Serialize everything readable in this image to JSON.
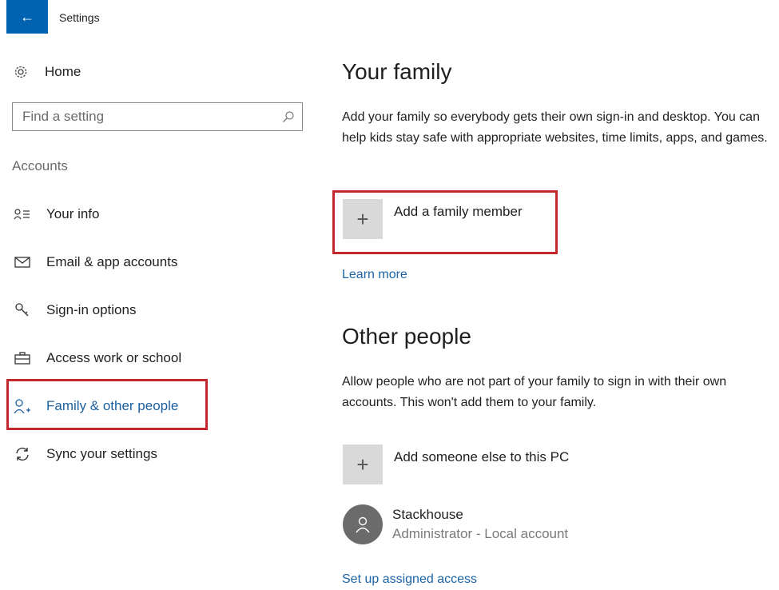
{
  "window": {
    "title": "Settings"
  },
  "sidebar": {
    "home_label": "Home",
    "search_placeholder": "Find a setting",
    "section_label": "Accounts",
    "items": [
      {
        "label": "Your info",
        "icon": "person-card-icon"
      },
      {
        "label": "Email & app accounts",
        "icon": "mail-icon"
      },
      {
        "label": "Sign-in options",
        "icon": "key-icon"
      },
      {
        "label": "Access work or school",
        "icon": "briefcase-icon"
      },
      {
        "label": "Family & other people",
        "icon": "person-add-icon",
        "active": true
      },
      {
        "label": "Sync your settings",
        "icon": "sync-icon"
      }
    ]
  },
  "main": {
    "family": {
      "title": "Your family",
      "description": "Add your family so everybody gets their own sign-in and desktop. You can help kids stay safe with appropriate websites, time limits, apps, and games.",
      "add_label": "Add a family member",
      "learn_more": "Learn more"
    },
    "others": {
      "title": "Other people",
      "description": "Allow people who are not part of your family to sign in with their own accounts. This won't add them to your family.",
      "add_label": "Add someone else to this PC",
      "user": {
        "name": "Stackhouse",
        "role": "Administrator - Local account"
      },
      "assigned_access": "Set up assigned access"
    }
  },
  "colors": {
    "accent": "#0063b1",
    "link": "#1b64a8",
    "highlight_box": "#c1272d"
  }
}
